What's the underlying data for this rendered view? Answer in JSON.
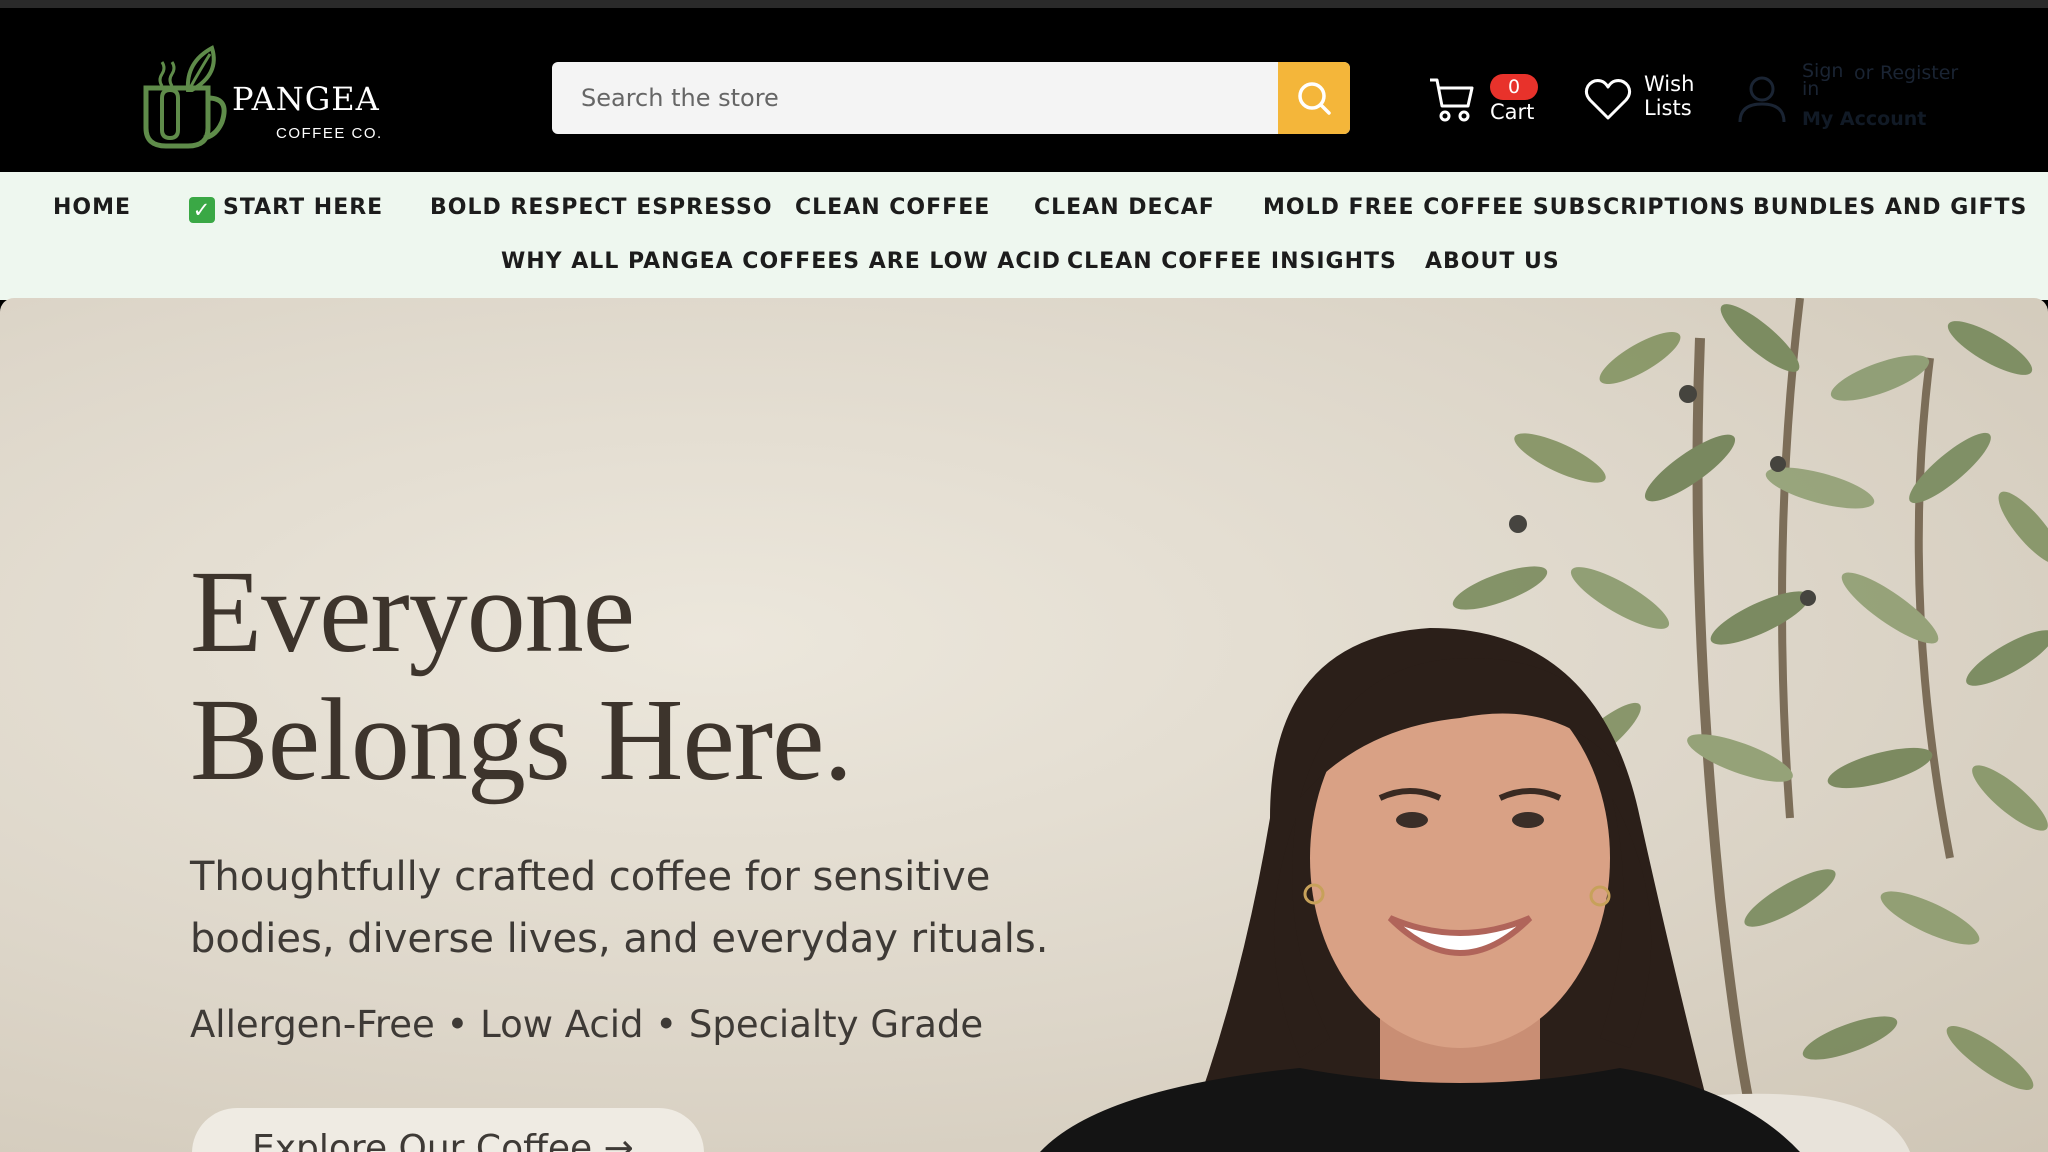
{
  "brand": {
    "name": "PANGEA",
    "sub": "COFFEE CO."
  },
  "search": {
    "placeholder": "Search the store"
  },
  "cart": {
    "count": "0",
    "label": "Cart"
  },
  "wishlist": {
    "line1": "Wish",
    "line2": "Lists"
  },
  "account": {
    "sign_in": "Sign in",
    "or": "or",
    "register": "Register",
    "my_account": "My Account"
  },
  "nav": {
    "row1": [
      "HOME",
      "START HERE",
      "BOLD RESPECT ESPRESSO",
      "CLEAN COFFEE",
      "CLEAN DECAF",
      "MOLD FREE COFFEE SUBSCRIPTIONS",
      "BUNDLES AND GIFTS"
    ],
    "row2": [
      "WHY ALL PANGEA COFFEES ARE LOW ACID",
      "CLEAN COFFEE INSIGHTS",
      "ABOUT US"
    ]
  },
  "hero": {
    "title_line1": "Everyone",
    "title_line2": "Belongs Here.",
    "subtitle_line1": "Thoughtfully crafted coffee for sensitive",
    "subtitle_line2": "bodies, diverse lives, and everyday rituals.",
    "tags": "Allergen-Free • Low Acid • Specialty Grade",
    "cta": "Explore Our Coffee →"
  },
  "colors": {
    "accent": "#f4b63a",
    "badge": "#e8322b",
    "nav_bg": "#eef7ef",
    "logo_green": "#5f8c4a"
  }
}
